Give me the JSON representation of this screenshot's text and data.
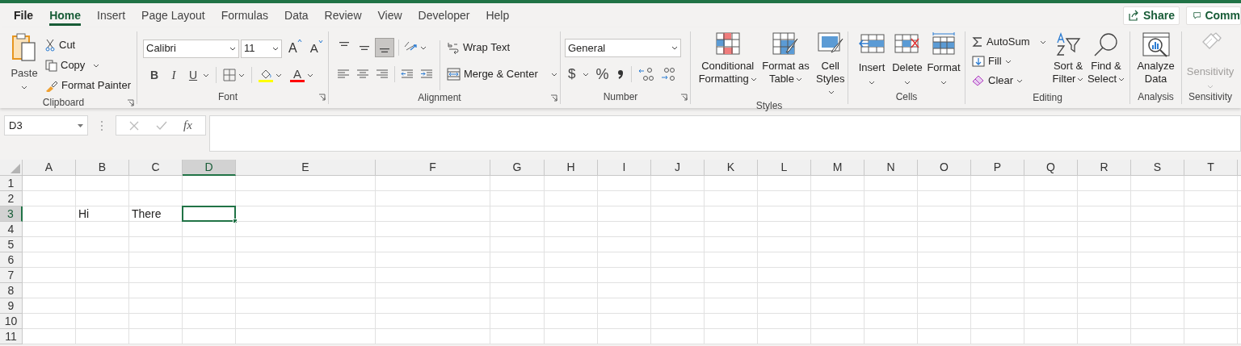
{
  "tabs": [
    {
      "label": "File",
      "selected": false
    },
    {
      "label": "Home",
      "selected": true
    },
    {
      "label": "Insert",
      "selected": false
    },
    {
      "label": "Page Layout",
      "selected": false
    },
    {
      "label": "Formulas",
      "selected": false
    },
    {
      "label": "Data",
      "selected": false
    },
    {
      "label": "Review",
      "selected": false
    },
    {
      "label": "View",
      "selected": false
    },
    {
      "label": "Developer",
      "selected": false
    },
    {
      "label": "Help",
      "selected": false
    }
  ],
  "share_button": "Share",
  "comments_button": "Comm",
  "ribbon": {
    "clipboard": {
      "paste": "Paste",
      "cut": "Cut",
      "copy": "Copy",
      "format_painter": "Format Painter",
      "label": "Clipboard"
    },
    "font": {
      "font_name": "Calibri",
      "font_size": "11",
      "grow_font": "A",
      "shrink_font": "A",
      "bold": "B",
      "italic": "I",
      "underline": "U",
      "font_color": "A",
      "label": "Font"
    },
    "alignment": {
      "vertical_align": [
        {
          "selected": false
        },
        {
          "selected": false
        },
        {
          "selected": true
        }
      ],
      "wrap_text": "Wrap Text",
      "merge_center": "Merge & Center",
      "label": "Alignment"
    },
    "number": {
      "format": "General",
      "currency": "$",
      "percent": "%",
      "label": "Number"
    },
    "styles": {
      "conditional_formatting": [
        "Conditional",
        "Formatting"
      ],
      "format_as_table": [
        "Format as",
        "Table"
      ],
      "cell_styles": [
        "Cell",
        "Styles"
      ],
      "label": "Styles"
    },
    "cells": {
      "insert": "Insert",
      "delete": "Delete",
      "format": "Format",
      "label": "Cells"
    },
    "editing": {
      "autosum": "AutoSum",
      "fill": "Fill",
      "clear": "Clear",
      "sort_filter": [
        "Sort &",
        "Filter"
      ],
      "find_select": [
        "Find &",
        "Select"
      ],
      "label": "Editing"
    },
    "analysis": {
      "analyze_data": [
        "Analyze",
        "Data"
      ],
      "label": "Analysis"
    },
    "sensitivity": {
      "button": "Sensitivity",
      "disabled": true,
      "label": "Sensitivity"
    }
  },
  "formula_bar": {
    "name_box": "D3",
    "function_button": "fx"
  },
  "sheet": {
    "columns": [
      {
        "label": "A",
        "selected": false
      },
      {
        "label": "B",
        "selected": false
      },
      {
        "label": "C",
        "selected": false
      },
      {
        "label": "D",
        "selected": true
      },
      {
        "label": "E",
        "selected": false
      },
      {
        "label": "F",
        "selected": false
      },
      {
        "label": "G",
        "selected": false
      },
      {
        "label": "H",
        "selected": false
      },
      {
        "label": "I",
        "selected": false
      },
      {
        "label": "J",
        "selected": false
      },
      {
        "label": "K",
        "selected": false
      },
      {
        "label": "L",
        "selected": false
      },
      {
        "label": "M",
        "selected": false
      },
      {
        "label": "N",
        "selected": false
      },
      {
        "label": "O",
        "selected": false
      },
      {
        "label": "P",
        "selected": false
      },
      {
        "label": "Q",
        "selected": false
      },
      {
        "label": "R",
        "selected": false
      },
      {
        "label": "S",
        "selected": false
      },
      {
        "label": "T",
        "selected": false
      }
    ],
    "rows": [
      {
        "label": "1",
        "selected": false
      },
      {
        "label": "2",
        "selected": false
      },
      {
        "label": "3",
        "selected": true,
        "cells": [
          {
            "selected": false
          },
          {
            "value": "Hi",
            "selected": false
          },
          {
            "value": "There",
            "selected": false
          },
          {
            "selected": true
          }
        ]
      },
      {
        "label": "4",
        "selected": false
      },
      {
        "label": "5",
        "selected": false
      },
      {
        "label": "6",
        "selected": false
      },
      {
        "label": "7",
        "selected": false
      },
      {
        "label": "8",
        "selected": false
      },
      {
        "label": "9",
        "selected": false
      },
      {
        "label": "10",
        "selected": false
      },
      {
        "label": "11",
        "selected": false
      }
    ]
  }
}
